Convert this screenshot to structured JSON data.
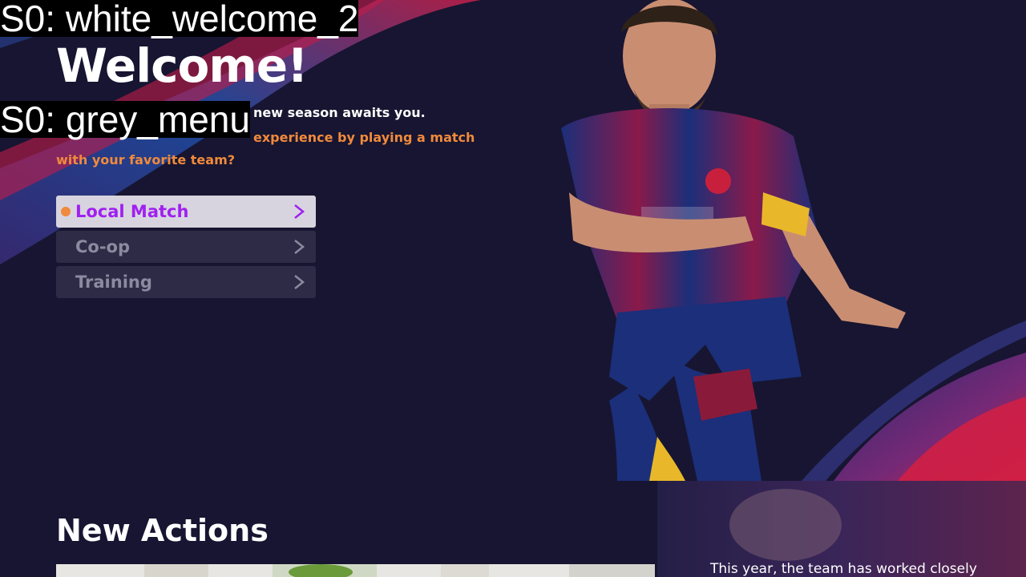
{
  "debug_labels": {
    "welcome": "S0: white_welcome_2",
    "menu": "S0: grey_menu"
  },
  "hero": {
    "title": "Welcome!",
    "line1": "new season awaits you.",
    "line2": "experience by playing a match with your favorite team?"
  },
  "menu": {
    "items": [
      {
        "label": "Local Match",
        "selected": true
      },
      {
        "label": "Co-op",
        "selected": false
      },
      {
        "label": "Training",
        "selected": false
      }
    ]
  },
  "bottom": {
    "title": "New Actions",
    "news_text": "This year, the team has worked closely"
  },
  "colors": {
    "background": "#171531",
    "accent_orange": "#f08a3c",
    "accent_purple": "#a020f0",
    "menu_item_bg": "#2d2b45",
    "menu_selected_bg": "#d7d4df"
  }
}
